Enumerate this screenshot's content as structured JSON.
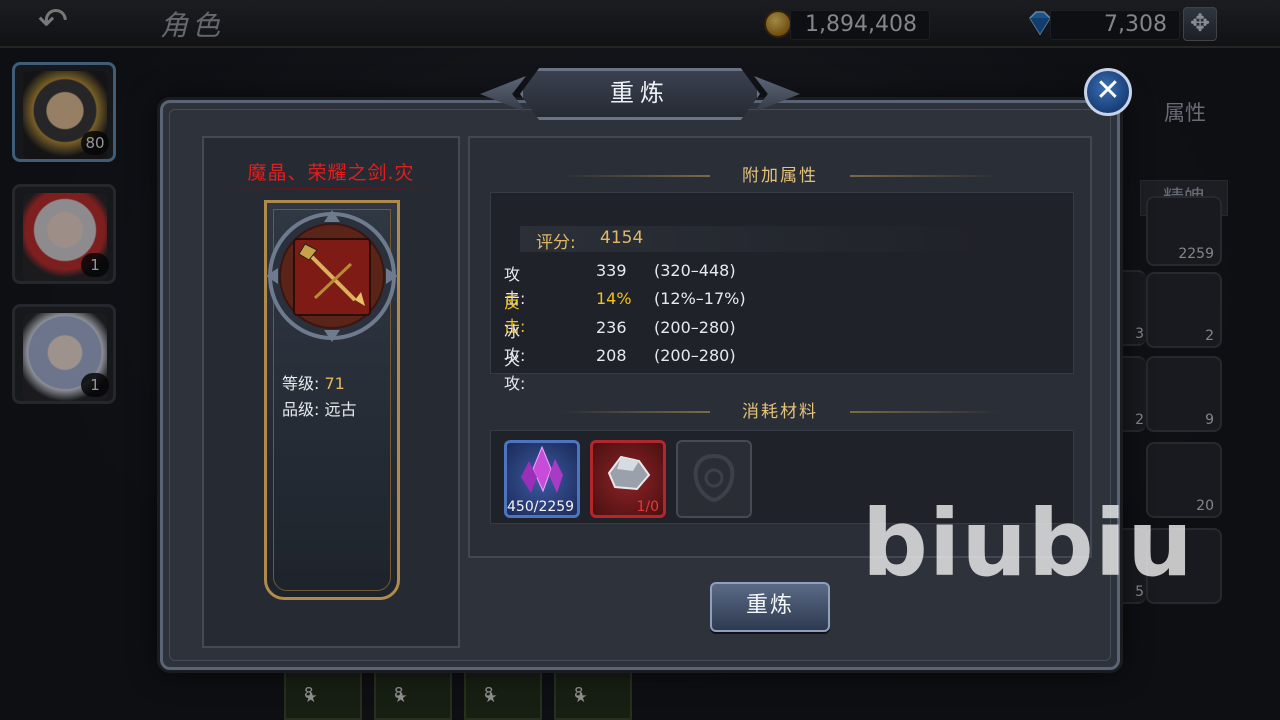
{
  "screen": {
    "title": "角色",
    "back_icon": "back-arrow-icon"
  },
  "resources": {
    "gold": "1,894,408",
    "gems": "7,308",
    "gold_icon": "gold-coin-icon",
    "gem_icon": "diamond-icon",
    "add_icon": "plus-icon"
  },
  "characters": [
    {
      "level": "80",
      "active": true
    },
    {
      "level": "1",
      "active": false
    },
    {
      "level": "1",
      "active": false
    }
  ],
  "background_panel": {
    "tab_attributes": "属性",
    "tab_spirit": "精魄",
    "item_counts": [
      "2259",
      "3",
      "2",
      "2",
      "9",
      "20",
      "5"
    ],
    "bottom_levels": [
      "8",
      "8",
      "8",
      "8"
    ]
  },
  "dialog": {
    "title": "重炼",
    "close_icon": "close-icon",
    "item": {
      "name": "魔晶、荣耀之剑.灾",
      "icon": "crossbow-weapon-icon",
      "level_label": "等级:",
      "level_value": "71",
      "grade_label": "品级:",
      "grade_value": "远古"
    },
    "attributes": {
      "heading": "附加属性",
      "score_label": "评分:",
      "score_value": "4154",
      "rows": [
        {
          "name": "攻击:",
          "value": "339",
          "range": "(320–448)",
          "highlight": false
        },
        {
          "name": "反击:",
          "value": "14%",
          "range": "(12%–17%)",
          "highlight": true
        },
        {
          "name": "冰攻:",
          "value": "236",
          "range": "(200–280)",
          "highlight": false
        },
        {
          "name": "火攻:",
          "value": "208",
          "range": "(200–280)",
          "highlight": false
        }
      ]
    },
    "materials": {
      "heading": "消耗材料",
      "items": [
        {
          "icon": "purple-crystal-icon",
          "count": "450/2259"
        },
        {
          "icon": "iron-ore-icon",
          "count": "1/0"
        },
        {
          "icon": "empty-slot-icon",
          "count": ""
        }
      ]
    },
    "refine_button": "重炼"
  },
  "watermark": "biubiu",
  "colors": {
    "item_name": "#e51d1d",
    "gold_text": "#e3c27a",
    "highlight": "#f1c21a",
    "close_button": "#2c5aa0"
  }
}
